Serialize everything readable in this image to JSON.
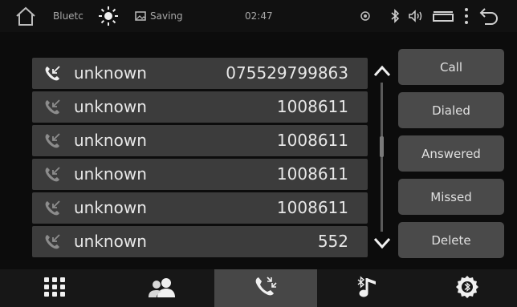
{
  "status_bar": {
    "source_label": "Bluetc",
    "saving_label": "Saving",
    "time": "02:47"
  },
  "call_log": {
    "rows": [
      {
        "name": "unknown",
        "number": "075529799863",
        "selected": true
      },
      {
        "name": "unknown",
        "number": "1008611",
        "selected": false
      },
      {
        "name": "unknown",
        "number": "1008611",
        "selected": false
      },
      {
        "name": "unknown",
        "number": "1008611",
        "selected": false
      },
      {
        "name": "unknown",
        "number": "1008611",
        "selected": false
      },
      {
        "name": "unknown",
        "number": "552",
        "selected": false
      }
    ]
  },
  "filters": {
    "call": "Call",
    "dialed": "Dialed",
    "answered": "Answered",
    "missed": "Missed",
    "delete": "Delete"
  },
  "bottom_nav": {
    "items": [
      {
        "icon": "dialpad-icon"
      },
      {
        "icon": "contacts-icon"
      },
      {
        "icon": "call-log-icon",
        "active": true
      },
      {
        "icon": "bluetooth-music-icon"
      },
      {
        "icon": "bluetooth-settings-icon"
      }
    ]
  },
  "colors": {
    "background": "#0c0c0c",
    "row": "#3c3c3c",
    "button": "#4a4a4a",
    "active_tab": "#474747",
    "text": "#e6e6e6"
  }
}
